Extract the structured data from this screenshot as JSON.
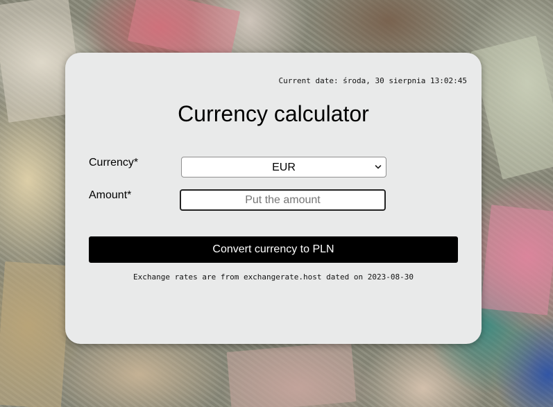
{
  "header": {
    "current_date": "Current date: środa, 30 sierpnia 13:02:45"
  },
  "main": {
    "title": "Currency calculator",
    "currency_label": "Currency*",
    "currency_selected": "EUR",
    "amount_label": "Amount*",
    "amount_placeholder": "Put the amount",
    "amount_value": "",
    "convert_label": "Convert currency to PLN",
    "rates_note": "Exchange rates are from exchangerate.host dated on 2023-08-30"
  },
  "icons": {
    "select_chevron": "chevron-down-icon"
  },
  "colors": {
    "card_background": "#e9eaea",
    "button_background": "#000000",
    "button_text": "#ffffff"
  }
}
